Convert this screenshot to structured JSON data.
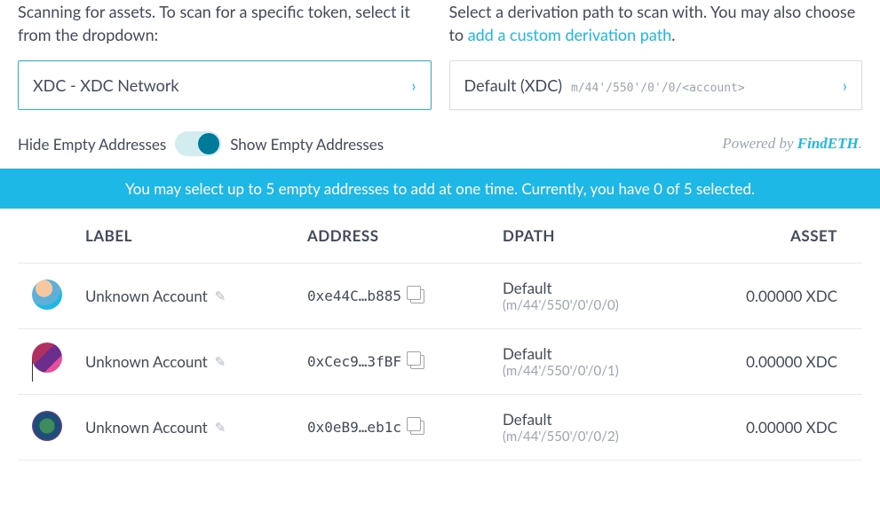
{
  "top": {
    "scanDesc": "Scanning for assets. To scan for a specific token, select it from the dropdown:",
    "tokenSelected": "XDC - XDC Network",
    "dpathDescPrefix": "Select a derivation path to scan with. You may also choose to ",
    "dpathLinkText": "add a custom derivation path",
    "dpathDescSuffix": ".",
    "dpathSelected": "Default (XDC)",
    "dpathMono": "m/44'/550'/0'/0/<account>"
  },
  "toggle": {
    "leftLabel": "Hide Empty Addresses",
    "rightLabel": "Show Empty Addresses"
  },
  "powered": {
    "prefix": "Powered by ",
    "brand": "FindETH",
    "suffix": "."
  },
  "banner": "You may select up to 5 empty addresses to add at one time. Currently, you have 0 of 5 selected.",
  "columns": {
    "label": "LABEL",
    "address": "ADDRESS",
    "dpath": "DPATH",
    "asset": "ASSET"
  },
  "rows": [
    {
      "label": "Unknown Account",
      "address": "0xe44C…b885",
      "dpathName": "Default",
      "dpathPath": "(m/44'/550'/0'/0/0)",
      "asset": "0.00000 XDC"
    },
    {
      "label": "Unknown Account",
      "address": "0xCec9…3fBF",
      "dpathName": "Default",
      "dpathPath": "(m/44'/550'/0'/0/1)",
      "asset": "0.00000 XDC"
    },
    {
      "label": "Unknown Account",
      "address": "0x0eB9…eb1c",
      "dpathName": "Default",
      "dpathPath": "(m/44'/550'/0'/0/2)",
      "asset": "0.00000 XDC"
    }
  ]
}
